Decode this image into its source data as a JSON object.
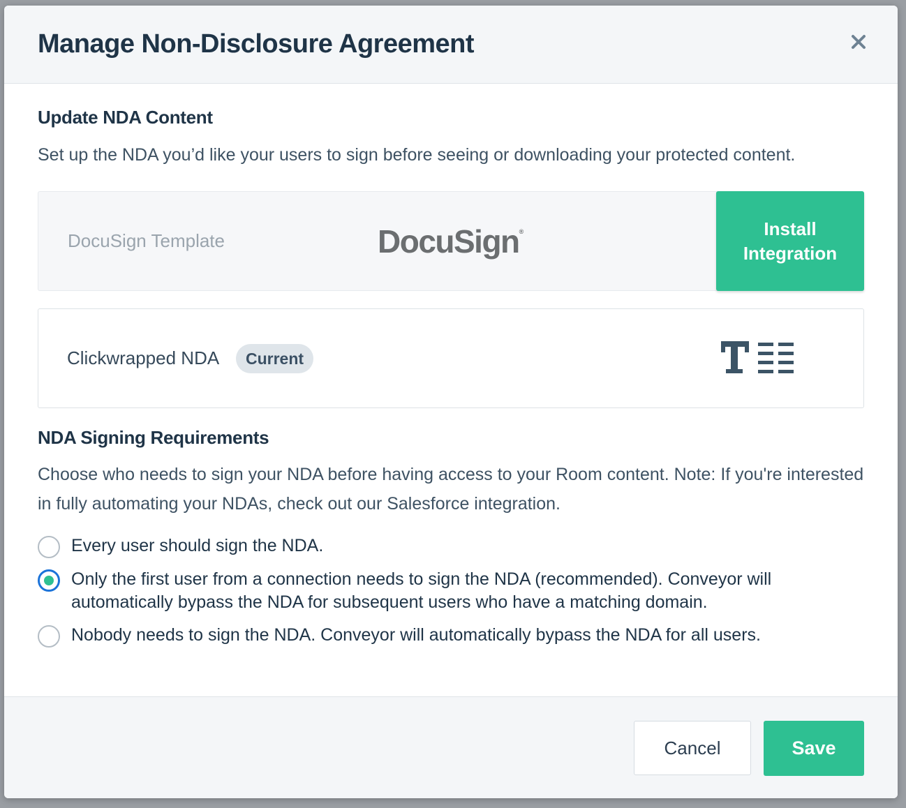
{
  "modal": {
    "title": "Manage Non-Disclosure Agreement",
    "close_icon": "close-icon"
  },
  "content_section": {
    "heading": "Update NDA Content",
    "description": "Set up the NDA you’d like your users to sign before seeing or downloading your protected content.",
    "docusign": {
      "label": "DocuSign Template",
      "logo_text": "DocuSign",
      "logo_mark": "®",
      "install_label": "Install\nIntegration"
    },
    "clickwrap": {
      "label": "Clickwrapped NDA",
      "badge": "Current",
      "icon": "text-document-icon"
    }
  },
  "signing_section": {
    "heading": "NDA Signing Requirements",
    "description": "Choose who needs to sign your NDA before having access to your Room content. Note: If you're interested in fully automating your NDAs, check out our Salesforce integration.",
    "options": [
      {
        "label": "Every user should sign the NDA.",
        "checked": false
      },
      {
        "label": "Only the first user from a connection needs to sign the NDA (recommended). Conveyor will automatically bypass the NDA for subsequent users who have a matching domain.",
        "checked": true
      },
      {
        "label": "Nobody needs to sign the NDA. Conveyor will automatically bypass the NDA for all users.",
        "checked": false
      }
    ]
  },
  "footer": {
    "cancel_label": "Cancel",
    "save_label": "Save"
  },
  "colors": {
    "accent": "#2ec092",
    "title_text": "#1f3447",
    "focus_ring": "#1b73d9",
    "badge_bg": "#dfe5ea"
  }
}
